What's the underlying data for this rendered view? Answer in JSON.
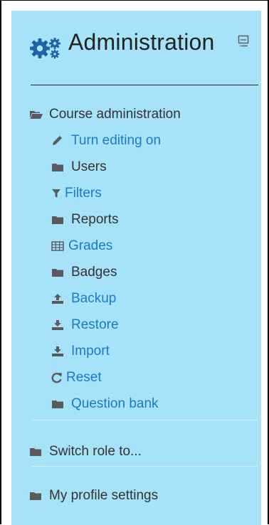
{
  "block": {
    "title": "Administration",
    "title_icon": "gears-icon",
    "dock_icon": "dock-icon"
  },
  "menu": {
    "course_admin": {
      "label": "Course administration",
      "icon": "folder-open-icon"
    },
    "items": [
      {
        "label": "Turn editing on",
        "icon": "pencil-icon",
        "link": true
      },
      {
        "label": "Users",
        "icon": "folder-icon",
        "link": false
      },
      {
        "label": "Filters",
        "icon": "filter-icon",
        "link": true
      },
      {
        "label": "Reports",
        "icon": "folder-icon",
        "link": false
      },
      {
        "label": "Grades",
        "icon": "table-icon",
        "link": true
      },
      {
        "label": "Badges",
        "icon": "folder-icon",
        "link": false
      },
      {
        "label": "Backup",
        "icon": "upload-icon",
        "link": true
      },
      {
        "label": "Restore",
        "icon": "download-icon",
        "link": true
      },
      {
        "label": "Import",
        "icon": "download-icon",
        "link": true
      },
      {
        "label": "Reset",
        "icon": "refresh-icon",
        "link": true
      },
      {
        "label": "Question bank",
        "icon": "folder-icon",
        "link": true
      }
    ],
    "switch_role": {
      "label": "Switch role to...",
      "icon": "folder-icon"
    },
    "profile_settings": {
      "label": "My profile settings",
      "icon": "folder-icon"
    }
  },
  "colors": {
    "block_bg": "#a7e3f8",
    "link": "#1a7bc4",
    "text": "#333333",
    "icon": "#5a5a5a"
  }
}
